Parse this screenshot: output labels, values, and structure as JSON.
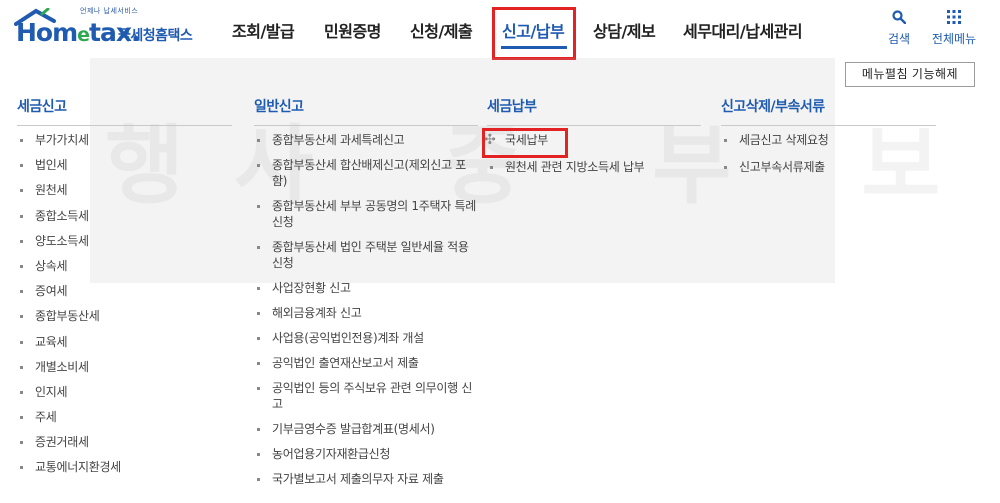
{
  "logo": {
    "small_text": "언제나 납세서비스",
    "main": "Hom",
    "main_e": "e",
    "main_tail": "tax.",
    "sub": "국세청홈택스"
  },
  "gnb": [
    {
      "label": "조회/발급"
    },
    {
      "label": "민원증명"
    },
    {
      "label": "신청/제출"
    },
    {
      "label": "신고/납부",
      "active": true
    },
    {
      "label": "상담/제보"
    },
    {
      "label": "세무대리/납세관리"
    }
  ],
  "util": {
    "search_label": "검색",
    "search_icon": "search-icon",
    "menu_label": "전체메뉴",
    "menu_icon": "grid-icon"
  },
  "collapse_button": "메뉴펼침 기능해제",
  "watermark": "행사 중 부 보",
  "columns": [
    {
      "title": "세금신고",
      "items": [
        "부가가치세",
        "법인세",
        "원천세",
        "종합소득세",
        "양도소득세",
        "상속세",
        "증여세",
        "종합부동산세",
        "교육세",
        "개별소비세",
        "인지세",
        "주세",
        "증권거래세",
        "교통에너지환경세"
      ]
    },
    {
      "title": "일반신고",
      "items": [
        "종합부동산세 과세특례신고",
        "종합부동산세 합산배제신고(제외신고 포함)",
        "종합부동산세 부부 공동명의 1주택자 특례 신청",
        "종합부동산세 법인 주택분 일반세율 적용 신청",
        "사업장현황 신고",
        "해외금융계좌 신고",
        "사업용(공익법인전용)계좌 개설",
        "공익법인 출연재산보고서 제출",
        "공익법인 등의 주식보유 관련 의무이행 신고",
        "기부금영수증 발급합계표(명세서)",
        "농어업용기자재환급신청",
        "국가별보고서 제출의무자 자료 제출"
      ]
    },
    {
      "title": "세금납부",
      "items": [
        "국세납부",
        "원천세 관련 지방소득세 납부"
      ]
    },
    {
      "title": "신고삭제/부속서류",
      "items": [
        "세금신고 삭제요청",
        "신고부속서류제출"
      ]
    }
  ],
  "colors": {
    "brand_blue": "#1f5bb0",
    "highlight_red": "#e32323",
    "logo_green": "#2fa84f"
  }
}
